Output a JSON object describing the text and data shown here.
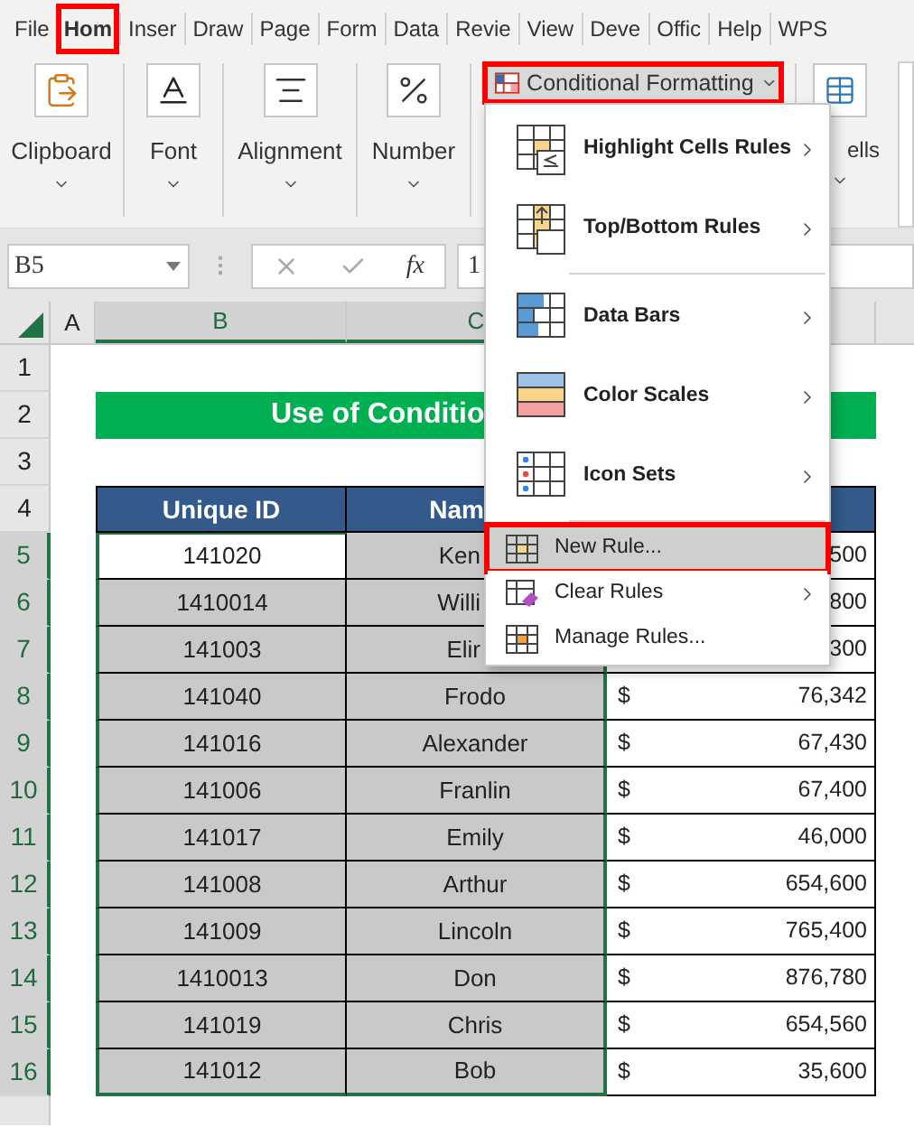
{
  "ribbon_tabs": [
    {
      "label": "File",
      "selected": false,
      "marked": false
    },
    {
      "label": "Hom",
      "selected": true,
      "marked": true
    },
    {
      "label": "Inser",
      "selected": false,
      "marked": false
    },
    {
      "label": "Draw",
      "selected": false,
      "marked": false
    },
    {
      "label": "Page",
      "selected": false,
      "marked": false
    },
    {
      "label": "Form",
      "selected": false,
      "marked": false
    },
    {
      "label": "Data",
      "selected": false,
      "marked": false
    },
    {
      "label": "Revie",
      "selected": false,
      "marked": false
    },
    {
      "label": "View",
      "selected": false,
      "marked": false
    },
    {
      "label": "Deve",
      "selected": false,
      "marked": false
    },
    {
      "label": "Offic",
      "selected": false,
      "marked": false
    },
    {
      "label": "Help",
      "selected": false,
      "marked": false
    },
    {
      "label": "WPS",
      "selected": false,
      "marked": false
    }
  ],
  "ribbon_groups": [
    {
      "label": "Clipboard"
    },
    {
      "label": "Font"
    },
    {
      "label": "Alignment"
    },
    {
      "label": "Number"
    }
  ],
  "conditional_formatting": {
    "label": "Conditional Formatting",
    "marked": true
  },
  "cells_group": {
    "label": "ells"
  },
  "formula_bar": {
    "name_box": "B5",
    "function_label": "fx",
    "value": "1"
  },
  "column_headers": [
    {
      "label": "A",
      "selected": false
    },
    {
      "label": "B",
      "selected": true
    },
    {
      "label": "C",
      "selected": true
    }
  ],
  "row_headers": [
    {
      "label": "1",
      "selected": false
    },
    {
      "label": "2",
      "selected": false
    },
    {
      "label": "3",
      "selected": false
    },
    {
      "label": "4",
      "selected": false
    },
    {
      "label": "5",
      "selected": true
    },
    {
      "label": "6",
      "selected": true
    },
    {
      "label": "7",
      "selected": true
    },
    {
      "label": "8",
      "selected": true
    },
    {
      "label": "9",
      "selected": true
    },
    {
      "label": "10",
      "selected": true
    },
    {
      "label": "11",
      "selected": true
    },
    {
      "label": "12",
      "selected": true
    },
    {
      "label": "13",
      "selected": true
    },
    {
      "label": "14",
      "selected": true
    },
    {
      "label": "15",
      "selected": true
    },
    {
      "label": "16",
      "selected": true
    }
  ],
  "title": "Use of Conditio",
  "table": {
    "columns": [
      "Unique ID",
      "Nam"
    ],
    "rows": [
      {
        "kind": "partial",
        "active": true,
        "id": "141020",
        "name": "Ken",
        "amount": "500"
      },
      {
        "kind": "partial",
        "active": false,
        "id": "1410014",
        "name": "Willi",
        "amount": "800"
      },
      {
        "kind": "partial",
        "active": false,
        "id": "141003",
        "name": "Elir",
        "amount": "300"
      },
      {
        "kind": "full",
        "active": false,
        "id": "141040",
        "name": "Frodo",
        "sign": "$",
        "amount": "76,342"
      },
      {
        "kind": "full",
        "active": false,
        "id": "141016",
        "name": "Alexander",
        "sign": "$",
        "amount": "67,430"
      },
      {
        "kind": "full",
        "active": false,
        "id": "141006",
        "name": "Franlin",
        "sign": "$",
        "amount": "67,400"
      },
      {
        "kind": "full",
        "active": false,
        "id": "141017",
        "name": "Emily",
        "sign": "$",
        "amount": "46,000"
      },
      {
        "kind": "full",
        "active": false,
        "id": "141008",
        "name": "Arthur",
        "sign": "$",
        "amount": "654,600"
      },
      {
        "kind": "full",
        "active": false,
        "id": "141009",
        "name": "Lincoln",
        "sign": "$",
        "amount": "765,400"
      },
      {
        "kind": "full",
        "active": false,
        "id": "1410013",
        "name": "Don",
        "sign": "$",
        "amount": "876,780"
      },
      {
        "kind": "full",
        "active": false,
        "id": "141019",
        "name": "Chris",
        "sign": "$",
        "amount": "654,560"
      },
      {
        "kind": "full",
        "active": false,
        "id": "141012",
        "name": "Bob",
        "sign": "$",
        "amount": "35,600"
      }
    ]
  },
  "menu": {
    "items": [
      {
        "kind": "large",
        "label": "Highlight Cells Rules",
        "submenu": true,
        "selected": false,
        "marked": false
      },
      {
        "kind": "large",
        "label": "Top/Bottom Rules",
        "submenu": true,
        "selected": false,
        "marked": false
      },
      {
        "kind": "separator"
      },
      {
        "kind": "large",
        "label": "Data Bars",
        "submenu": true,
        "selected": false,
        "marked": false
      },
      {
        "kind": "large",
        "label": "Color Scales",
        "submenu": true,
        "selected": false,
        "marked": false
      },
      {
        "kind": "large",
        "label": "Icon Sets",
        "submenu": true,
        "selected": false,
        "marked": false
      },
      {
        "kind": "separator"
      },
      {
        "kind": "small",
        "label": "New Rule...",
        "submenu": false,
        "selected": true,
        "marked": true
      },
      {
        "kind": "small",
        "label": "Clear Rules",
        "submenu": true,
        "selected": false,
        "marked": false
      },
      {
        "kind": "small",
        "label": "Manage Rules...",
        "submenu": false,
        "selected": false,
        "marked": false
      }
    ]
  }
}
